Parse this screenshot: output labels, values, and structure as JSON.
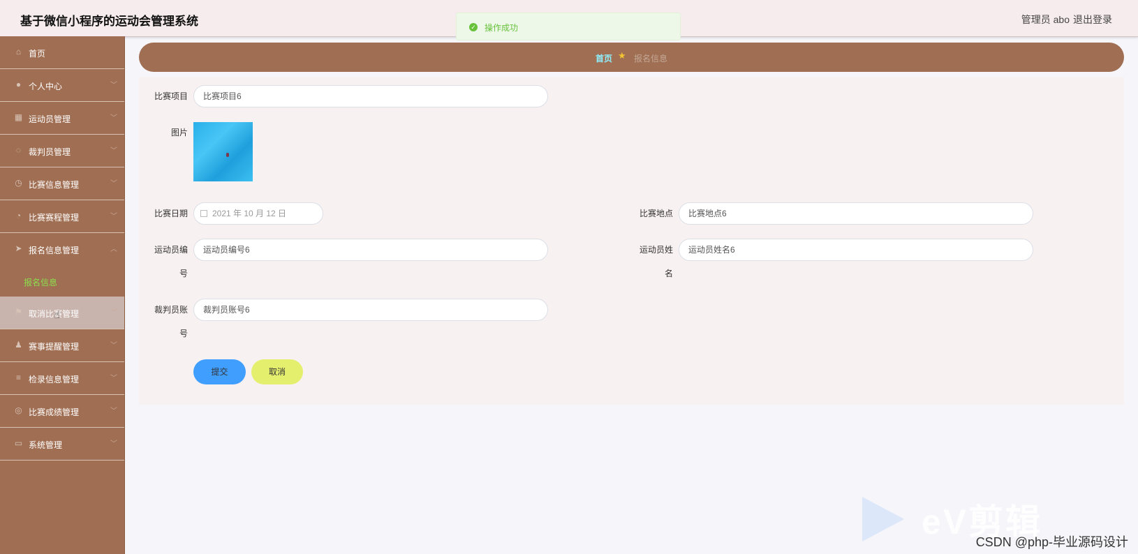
{
  "header": {
    "title": "基于微信小程序的运动会管理系统",
    "user": "管理员 abo",
    "logout": "退出登录"
  },
  "toast": {
    "message": "操作成功",
    "color": "#67c23a"
  },
  "sidebar": {
    "items": [
      {
        "label": "首页",
        "icon": "home-icon"
      },
      {
        "label": "个人中心",
        "icon": "user-icon"
      },
      {
        "label": "运动员管理",
        "icon": "athlete-icon"
      },
      {
        "label": "裁判员管理",
        "icon": "referee-icon"
      },
      {
        "label": "比赛信息管理",
        "icon": "clock-icon"
      },
      {
        "label": "比赛赛程管理",
        "icon": "compass-icon"
      },
      {
        "label": "报名信息管理",
        "icon": "send-icon"
      },
      {
        "label": "取消比赛管理",
        "icon": "flag-icon"
      },
      {
        "label": "赛事提醒管理",
        "icon": "person-icon"
      },
      {
        "label": "检录信息管理",
        "icon": "list-icon"
      },
      {
        "label": "比赛成绩管理",
        "icon": "globe-icon"
      },
      {
        "label": "系统管理",
        "icon": "chat-icon"
      }
    ],
    "submenu": {
      "label": "报名信息"
    }
  },
  "breadcrumb": {
    "home": "首页",
    "current": "报名信息"
  },
  "form": {
    "project_label": "比赛项目",
    "project_value": "比赛项目6",
    "image_label": "图片",
    "date_label": "比赛日期",
    "date_value": "2021 年 10 月 12 日",
    "place_label": "比赛地点",
    "place_value": "比赛地点6",
    "athlete_no_label_1": "运动员编",
    "athlete_no_label_2": "号",
    "athlete_no_value": "运动员编号6",
    "athlete_name_label_1": "运动员姓",
    "athlete_name_label_2": "名",
    "athlete_name_value": "运动员姓名6",
    "referee_label_1": "裁判员账",
    "referee_label_2": "号",
    "referee_value": "裁判员账号6",
    "submit": "提交",
    "cancel": "取消"
  },
  "watermark": {
    "brand": "eV剪辑",
    "credit": "CSDN @php-毕业源码设计"
  },
  "colors": {
    "sidebar": "#a06e52",
    "accent": "#409eff",
    "cancel": "#e5ef6e",
    "submenu_active": "#8be04e"
  }
}
